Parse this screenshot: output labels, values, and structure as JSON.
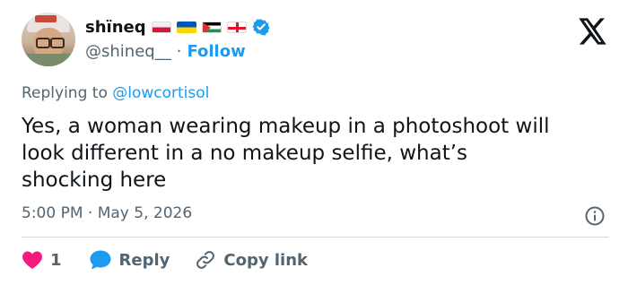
{
  "author": {
    "display_name": "shïneq",
    "handle": "@shineq__",
    "follow_label": "Follow",
    "flags": [
      "poland-flag",
      "ukraine-flag",
      "palestine-flag",
      "georgia-flag"
    ],
    "verified_color": "#1d9bf0"
  },
  "platform": {
    "logo": "x-logo-icon"
  },
  "reply_context": {
    "prefix": "Replying to ",
    "mention": "@lowcortisol"
  },
  "post": {
    "text": "Yes, a woman wearing makeup in a photoshoot will\nlook different in a no makeup selfie, what’s\nshocking here",
    "timestamp": "5:00 PM · May 5, 2026"
  },
  "actions": {
    "like_count": "1",
    "reply_label": "Reply",
    "copy_label": "Copy link"
  },
  "colors": {
    "accent": "#1d9bf0",
    "like": "#f91880",
    "text": "#0f1419",
    "muted": "#536471"
  }
}
